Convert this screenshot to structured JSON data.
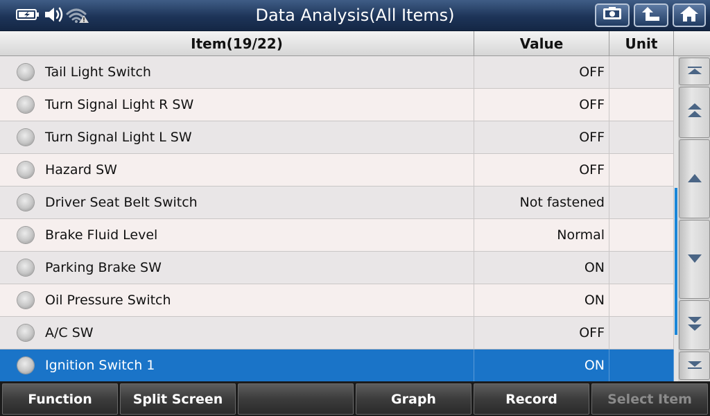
{
  "header": {
    "title": "Data Analysis(All Items)",
    "status_icons": [
      "battery-charging-icon",
      "speaker-icon",
      "wifi-warning-icon"
    ],
    "buttons": [
      "screenshot-icon",
      "back-arrow-icon",
      "home-icon"
    ]
  },
  "table": {
    "columns": {
      "item": "Item(19/22)",
      "value": "Value",
      "unit": "Unit"
    },
    "rows": [
      {
        "item": "Tail Light Switch",
        "value": "OFF",
        "unit": ""
      },
      {
        "item": "Turn Signal Light R SW",
        "value": "OFF",
        "unit": ""
      },
      {
        "item": "Turn Signal Light L SW",
        "value": "OFF",
        "unit": ""
      },
      {
        "item": "Hazard SW",
        "value": "OFF",
        "unit": ""
      },
      {
        "item": "Driver Seat Belt Switch",
        "value": "Not fastened",
        "unit": ""
      },
      {
        "item": "Brake Fluid Level",
        "value": "Normal",
        "unit": ""
      },
      {
        "item": "Parking Brake SW",
        "value": "ON",
        "unit": ""
      },
      {
        "item": "Oil Pressure Switch",
        "value": "ON",
        "unit": ""
      },
      {
        "item": "A/C SW",
        "value": "OFF",
        "unit": ""
      },
      {
        "item": "Ignition Switch 1",
        "value": "ON",
        "unit": ""
      }
    ],
    "selected_row": 9
  },
  "scroll": {
    "buttons": [
      "scroll-top-icon",
      "page-up-icon",
      "line-up-icon",
      "line-down-icon",
      "page-down-icon",
      "scroll-bottom-icon"
    ]
  },
  "footer": {
    "buttons": [
      {
        "label": "Function",
        "enabled": true
      },
      {
        "label": "Split Screen",
        "enabled": true
      },
      {
        "label": "",
        "enabled": true
      },
      {
        "label": "Graph",
        "enabled": true
      },
      {
        "label": "Record",
        "enabled": true
      },
      {
        "label": "Select Item",
        "enabled": false
      }
    ]
  },
  "colors": {
    "selected_row": "#1a74c8",
    "title_bar": "#1d3458",
    "scroll_thumb": "#1a86d8"
  }
}
